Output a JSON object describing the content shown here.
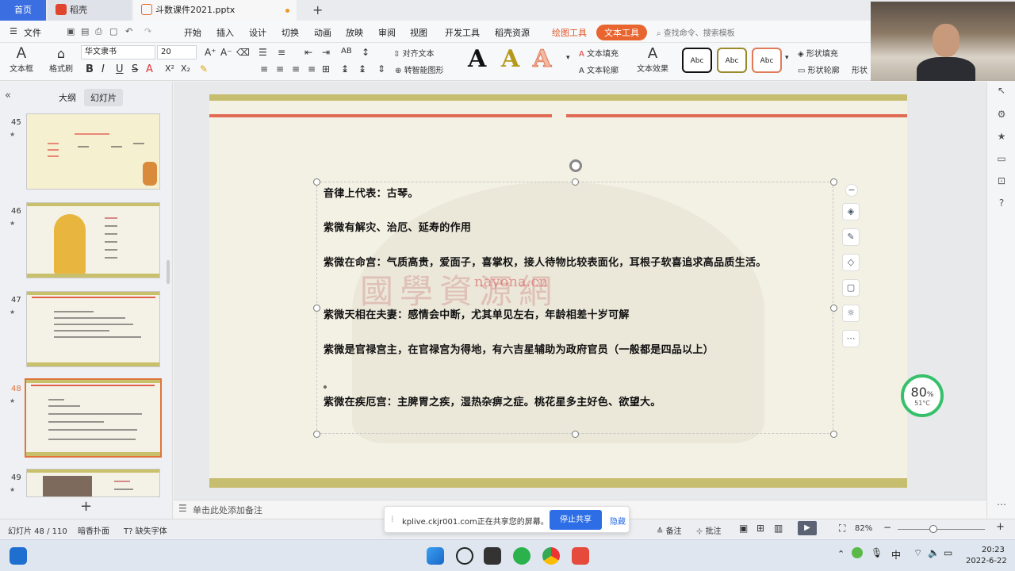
{
  "tabs": {
    "home": "首页",
    "docer": "稻壳",
    "file": "斗数课件2021.pptx"
  },
  "menu": {
    "file": "文件",
    "items": [
      "开始",
      "插入",
      "设计",
      "切换",
      "动画",
      "放映",
      "审阅",
      "视图",
      "开发工具",
      "稻壳资源"
    ],
    "drawing_tools": "绘图工具",
    "text_tools": "文本工具",
    "search_placeholder": "查找命令、搜索模板"
  },
  "ribbon": {
    "textbox": "文本框",
    "format_painter": "格式刷",
    "font_name": "华文隶书",
    "font_size": "20",
    "align_text": "对齐文本",
    "smart_shape": "转智能图形",
    "text_fill": "文本填充",
    "text_outline": "文本轮廓",
    "text_effect": "文本效果",
    "shape_fill": "形状填充",
    "shape_outline": "形状轮廓",
    "shape_effect": "形状",
    "style_label": "Abc",
    "big_a": "A"
  },
  "left_panel": {
    "outline_tab": "大纲",
    "slides_tab": "幻灯片",
    "slide_numbers": [
      "45",
      "46",
      "47",
      "48",
      "49"
    ],
    "star": "★",
    "selected": "48"
  },
  "slide": {
    "paragraphs": [
      "音律上代表：古琴。",
      "紫微有解灾、治厄、延寿的作用",
      "紫微在命宫：气质高贵，爱面子，喜掌权，接人待物比较表面化，耳根子软喜追求高品质生活。",
      "紫微天相在夫妻：感情会中断，尤其单见左右，年龄相差十岁可解",
      "紫微是官禄宫主，在官禄宫为得地，有六吉星辅助为政府官员（一般都是四品以上）",
      "。",
      "紫微在疾厄宫：主脾胃之疾，湿热杂痹之症。桃花星多主好色、欲望大。"
    ],
    "watermark": "國學資源網",
    "watermark_url": "nayona.cn"
  },
  "gauge": {
    "value": "80",
    "unit": "%",
    "temp": "51°C"
  },
  "notes": {
    "placeholder": "单击此处添加备注"
  },
  "share": {
    "message": "kplive.ckjr001.com正在共享您的屏幕。",
    "stop": "停止共享",
    "hide": "隐藏"
  },
  "status": {
    "slide_counter": "幻灯片 48 / 110",
    "theme": "暗香扑面",
    "missing_font": "缺失字体",
    "notes": "备注",
    "comments": "批注",
    "zoom": "82%"
  },
  "taskbar": {
    "ime": "中",
    "time": "20:23",
    "date": "2022-6-22"
  },
  "colors": {
    "accent_orange": "#e8652f",
    "tab_blue": "#3b6ee0",
    "slide_band": "#c6bd6e",
    "slide_red": "#e06a53"
  }
}
